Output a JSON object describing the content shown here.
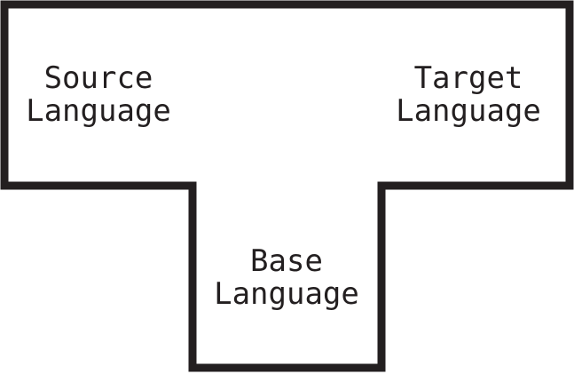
{
  "diagram": {
    "source": {
      "line1": "Source",
      "line2": "Language"
    },
    "target": {
      "line1": "Target",
      "line2": "Language"
    },
    "base": {
      "line1": "Base",
      "line2": "Language"
    }
  },
  "colors": {
    "stroke": "#231f20",
    "text": "#231f20",
    "background": "#ffffff"
  }
}
